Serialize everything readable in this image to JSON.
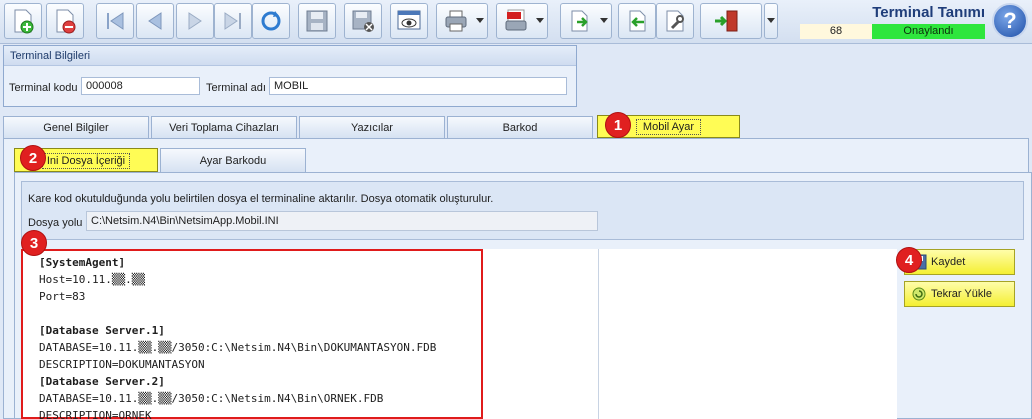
{
  "header": {
    "title": "Terminal Tanımı",
    "record_count": "68",
    "status": "Onaylandı",
    "help_label": "?"
  },
  "toolbar": {
    "icons": [
      "new-document-icon",
      "delete-document-icon",
      "first-record-icon",
      "previous-record-icon",
      "next-record-icon",
      "last-record-icon",
      "refresh-icon",
      "save-icon",
      "save-close-icon",
      "preview-icon",
      "print-icon",
      "pdf-export-icon",
      "export-icon",
      "import-icon",
      "settings-icon",
      "exit-icon"
    ]
  },
  "terminal_info": {
    "group_title": "Terminal Bilgileri",
    "code_label": "Terminal kodu",
    "code_value": "000008",
    "name_label": "Terminal adı",
    "name_value": "MOBIL"
  },
  "tabs": [
    {
      "label": "Genel Bilgiler"
    },
    {
      "label": "Veri Toplama Cihazları"
    },
    {
      "label": "Yazıcılar"
    },
    {
      "label": "Barkod"
    },
    {
      "label": "Mobil Ayar"
    }
  ],
  "subtabs": [
    {
      "label": "Ini Dosya İçeriği"
    },
    {
      "label": "Ayar Barkodu"
    }
  ],
  "info": {
    "description": "Kare kod okutulduğunda yolu belirtilen dosya el terminaline aktarılır. Dosya otomatik oluşturulur.",
    "path_label": "Dosya yolu",
    "path_value": "C:\\Netsim.N4\\Bin\\NetsimApp.Mobil.INI"
  },
  "ini_lines": [
    "[SystemAgent]",
    "Host=10.11.▒▒.▒▒",
    "Port=83",
    "",
    "[Database Server.1]",
    "DATABASE=10.11.▒▒.▒▒/3050:C:\\Netsim.N4\\Bin\\DOKUMANTASYON.FDB",
    "DESCRIPTION=DOKUMANTASYON",
    "[Database Server.2]",
    "DATABASE=10.11.▒▒.▒▒/3050:C:\\Netsim.N4\\Bin\\ORNEK.FDB",
    "DESCRIPTION=ORNEK"
  ],
  "actions": {
    "save_label": "Kaydet",
    "reload_label": "Tekrar Yükle"
  },
  "markers": [
    "1",
    "2",
    "3",
    "4"
  ],
  "colors": {
    "active_tab": "#fffc55",
    "approved": "#2ee63d",
    "highlight_border": "#e01b1b",
    "marker": "#e02020"
  }
}
